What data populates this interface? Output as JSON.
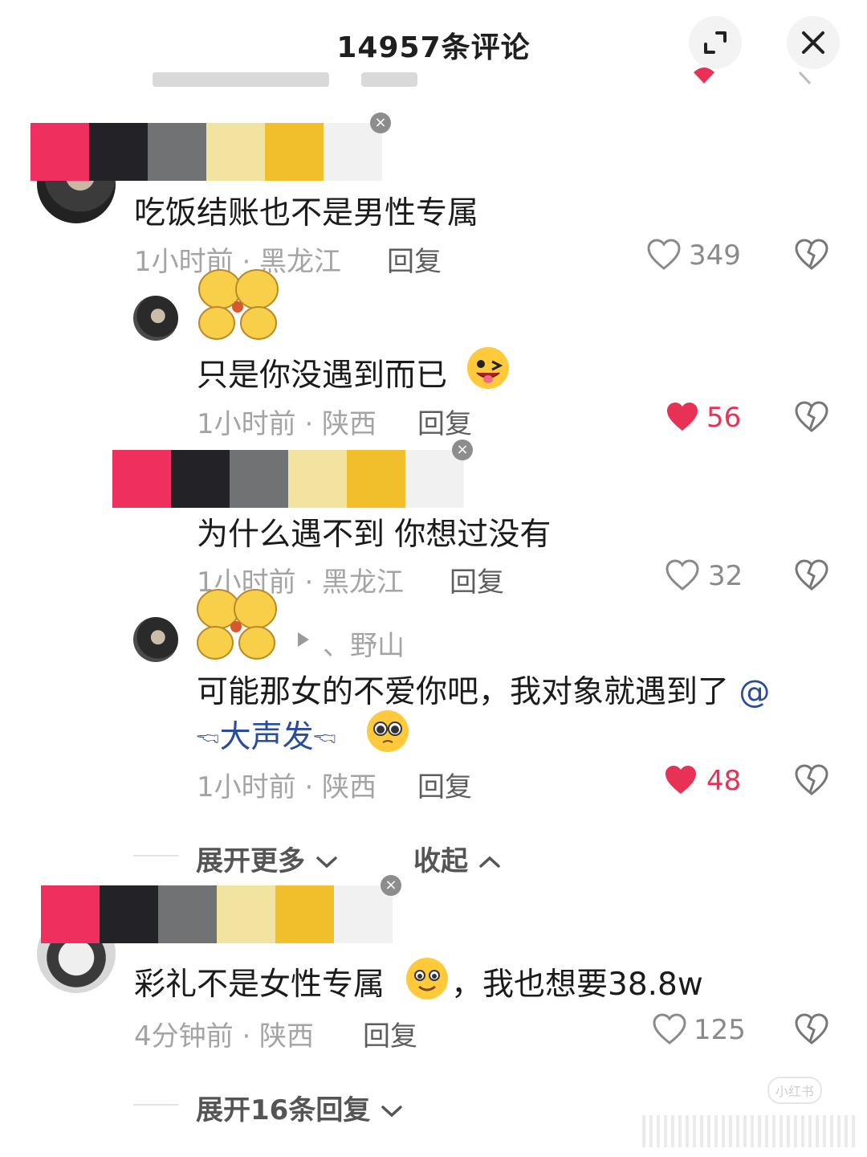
{
  "header": {
    "title": "14957条评论"
  },
  "palette_colors": [
    "#ef2f5e",
    "#232327",
    "#717273",
    "#f2e3a0",
    "#f0bf2b",
    "#f1f1f1"
  ],
  "icons": {
    "expand": "expand-arrows-icon",
    "close": "close-icon",
    "like": "heart-icon",
    "dislike": "broken-heart-icon",
    "chevron_down": "chevron-down-icon",
    "chevron_up": "chevron-up-icon",
    "reply_arrow": "play-arrow-icon"
  },
  "accent": {
    "liked_color": "#e83255",
    "mention_color": "#2a4c9c"
  },
  "comments": [
    {
      "text": "吃饭结账也不是男性专属",
      "meta": "1小时前 · 黑龙江",
      "reply_label": "回复",
      "likes": "349",
      "liked": false
    },
    {
      "text": "只是你没遇到而已",
      "meta": "1小时前 · 陕西",
      "reply_label": "回复",
      "likes": "56",
      "liked": true
    },
    {
      "text": "为什么遇不到 你想过没有",
      "meta": "1小时前 · 黑龙江",
      "reply_label": "回复",
      "likes": "32",
      "liked": false
    },
    {
      "reply_to": "、野山",
      "text": "可能那女的不爱你吧，我对象就遇到了",
      "mention_at": "@",
      "mention_name": "🖘大声发🖘",
      "meta": "1小时前 · 陕西",
      "reply_label": "回复",
      "likes": "48",
      "liked": true
    },
    {
      "text": "彩礼不是女性专属",
      "text_after": "，我也想要38.8w",
      "meta": "4分钟前 · 陕西",
      "reply_label": "回复",
      "likes": "125",
      "liked": false
    }
  ],
  "thread_controls": {
    "expand_more": "展开更多",
    "collapse": "收起"
  },
  "footer": {
    "expand_replies": "展开16条回复",
    "watermark": "小红书"
  }
}
